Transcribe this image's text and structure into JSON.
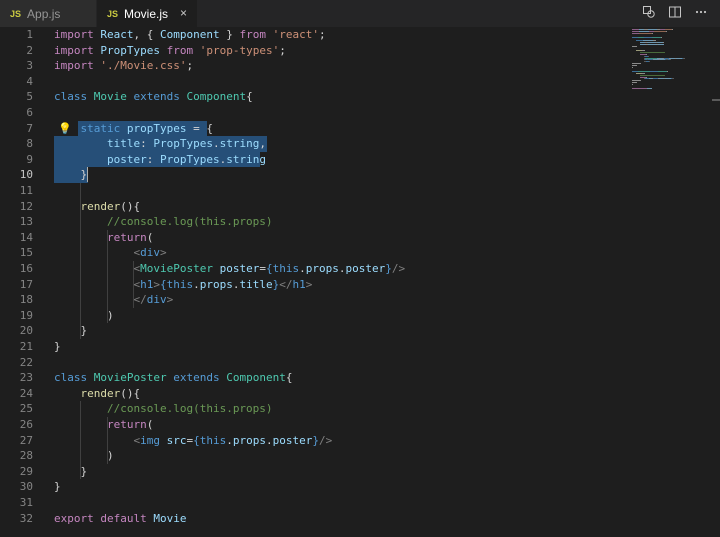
{
  "tabs": [
    {
      "badge": "JS",
      "name": "App.js",
      "active": false
    },
    {
      "badge": "JS",
      "name": "Movie.js",
      "active": true
    }
  ],
  "tab_close_glyph": "×",
  "lines": [
    {
      "n": "1",
      "t": [
        [
          "ctl",
          "import "
        ],
        [
          "var",
          "React"
        ],
        [
          "txt",
          ", { "
        ],
        [
          "var",
          "Component"
        ],
        [
          "txt",
          " } "
        ],
        [
          "ctl",
          "from "
        ],
        [
          "str",
          "'react'"
        ],
        [
          "txt",
          ";"
        ]
      ]
    },
    {
      "n": "2",
      "t": [
        [
          "ctl",
          "import "
        ],
        [
          "var",
          "PropTypes "
        ],
        [
          "ctl",
          "from "
        ],
        [
          "str",
          "'prop-types'"
        ],
        [
          "txt",
          ";"
        ]
      ]
    },
    {
      "n": "3",
      "t": [
        [
          "ctl",
          "import "
        ],
        [
          "str",
          "'./Movie.css'"
        ],
        [
          "txt",
          ";"
        ]
      ]
    },
    {
      "n": "4",
      "t": []
    },
    {
      "n": "5",
      "t": [
        [
          "kw",
          "class "
        ],
        [
          "cls",
          "Movie "
        ],
        [
          "kw",
          "extends "
        ],
        [
          "cls",
          "Component"
        ],
        [
          "txt",
          "{"
        ]
      ]
    },
    {
      "n": "6",
      "t": []
    },
    {
      "n": "7",
      "t": [
        [
          "txt",
          "    "
        ],
        [
          "kw",
          "static "
        ],
        [
          "var",
          "propTypes "
        ],
        [
          "txt",
          "= {"
        ]
      ]
    },
    {
      "n": "8",
      "t": [
        [
          "txt",
          "        "
        ],
        [
          "var",
          "title"
        ],
        [
          "txt",
          ": "
        ],
        [
          "var",
          "PropTypes"
        ],
        [
          "txt",
          "."
        ],
        [
          "var",
          "string"
        ],
        [
          "txt",
          ","
        ]
      ]
    },
    {
      "n": "9",
      "t": [
        [
          "txt",
          "        "
        ],
        [
          "var",
          "poster"
        ],
        [
          "txt",
          ": "
        ],
        [
          "var",
          "PropTypes"
        ],
        [
          "txt",
          "."
        ],
        [
          "var",
          "string"
        ]
      ]
    },
    {
      "n": "10",
      "t": [
        [
          "txt",
          "    }"
        ]
      ]
    },
    {
      "n": "11",
      "t": []
    },
    {
      "n": "12",
      "t": [
        [
          "txt",
          "    "
        ],
        [
          "fn",
          "render"
        ],
        [
          "txt",
          "(){"
        ]
      ]
    },
    {
      "n": "13",
      "t": [
        [
          "txt",
          "        "
        ],
        [
          "cmt",
          "//console.log(this.props)"
        ]
      ]
    },
    {
      "n": "14",
      "t": [
        [
          "txt",
          "        "
        ],
        [
          "ctl",
          "return"
        ],
        [
          "txt",
          "("
        ]
      ]
    },
    {
      "n": "15",
      "t": [
        [
          "txt",
          "            "
        ],
        [
          "punc",
          "<"
        ],
        [
          "tag",
          "div"
        ],
        [
          "punc",
          ">"
        ]
      ]
    },
    {
      "n": "16",
      "t": [
        [
          "txt",
          "            "
        ],
        [
          "punc",
          "<"
        ],
        [
          "cmp",
          "MoviePoster "
        ],
        [
          "var",
          "poster"
        ],
        [
          "txt",
          "="
        ],
        [
          "brace",
          "{"
        ],
        [
          "kw",
          "this"
        ],
        [
          "txt",
          "."
        ],
        [
          "var",
          "props"
        ],
        [
          "txt",
          "."
        ],
        [
          "var",
          "poster"
        ],
        [
          "brace",
          "}"
        ],
        [
          "punc",
          "/>"
        ]
      ]
    },
    {
      "n": "17",
      "t": [
        [
          "txt",
          "            "
        ],
        [
          "punc",
          "<"
        ],
        [
          "tag",
          "h1"
        ],
        [
          "punc",
          ">"
        ],
        [
          "brace",
          "{"
        ],
        [
          "kw",
          "this"
        ],
        [
          "txt",
          "."
        ],
        [
          "var",
          "props"
        ],
        [
          "txt",
          "."
        ],
        [
          "var",
          "title"
        ],
        [
          "brace",
          "}"
        ],
        [
          "punc",
          "</"
        ],
        [
          "tag",
          "h1"
        ],
        [
          "punc",
          ">"
        ]
      ]
    },
    {
      "n": "18",
      "t": [
        [
          "txt",
          "            "
        ],
        [
          "punc",
          "</"
        ],
        [
          "tag",
          "div"
        ],
        [
          "punc",
          ">"
        ]
      ]
    },
    {
      "n": "19",
      "t": [
        [
          "txt",
          "        )"
        ]
      ]
    },
    {
      "n": "20",
      "t": [
        [
          "txt",
          "    }"
        ]
      ]
    },
    {
      "n": "21",
      "t": [
        [
          "txt",
          "}"
        ]
      ]
    },
    {
      "n": "22",
      "t": []
    },
    {
      "n": "23",
      "t": [
        [
          "kw",
          "class "
        ],
        [
          "cls",
          "MoviePoster "
        ],
        [
          "kw",
          "extends "
        ],
        [
          "cls",
          "Component"
        ],
        [
          "txt",
          "{"
        ]
      ]
    },
    {
      "n": "24",
      "t": [
        [
          "txt",
          "    "
        ],
        [
          "fn",
          "render"
        ],
        [
          "txt",
          "(){"
        ]
      ]
    },
    {
      "n": "25",
      "t": [
        [
          "txt",
          "        "
        ],
        [
          "cmt",
          "//console.log(this.props)"
        ]
      ]
    },
    {
      "n": "26",
      "t": [
        [
          "txt",
          "        "
        ],
        [
          "ctl",
          "return"
        ],
        [
          "txt",
          "("
        ]
      ]
    },
    {
      "n": "27",
      "t": [
        [
          "txt",
          "            "
        ],
        [
          "punc",
          "<"
        ],
        [
          "tag",
          "img "
        ],
        [
          "var",
          "src"
        ],
        [
          "txt",
          "="
        ],
        [
          "brace",
          "{"
        ],
        [
          "kw",
          "this"
        ],
        [
          "txt",
          "."
        ],
        [
          "var",
          "props"
        ],
        [
          "txt",
          "."
        ],
        [
          "var",
          "poster"
        ],
        [
          "brace",
          "}"
        ],
        [
          "punc",
          "/>"
        ]
      ]
    },
    {
      "n": "28",
      "t": [
        [
          "txt",
          "        )"
        ]
      ]
    },
    {
      "n": "29",
      "t": [
        [
          "txt",
          "    }"
        ]
      ]
    },
    {
      "n": "30",
      "t": [
        [
          "txt",
          "}"
        ]
      ]
    },
    {
      "n": "31",
      "t": []
    },
    {
      "n": "32",
      "t": [
        [
          "ctl",
          "export "
        ],
        [
          "ctl",
          "default "
        ],
        [
          "var",
          "Movie"
        ]
      ]
    }
  ],
  "current_line": "10",
  "selection_lines": [
    "7",
    "8",
    "9",
    "10"
  ]
}
